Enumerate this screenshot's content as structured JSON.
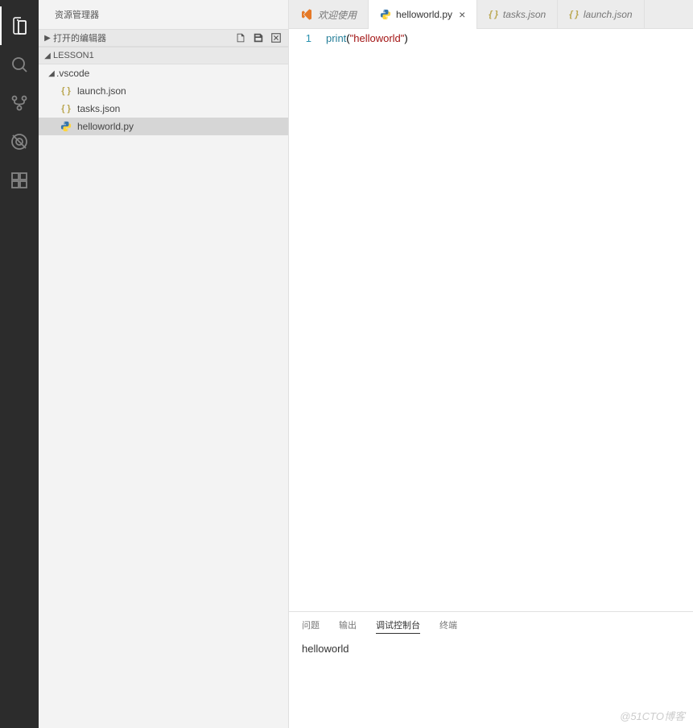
{
  "activity_bar": {
    "items": [
      "files",
      "search",
      "source-control",
      "debug",
      "extensions"
    ]
  },
  "sidebar": {
    "title": "资源管理器",
    "sections": {
      "open_editors": {
        "label": "打开的编辑器",
        "expanded": false
      },
      "folder": {
        "label": "LESSON1",
        "expanded": true,
        "tree": [
          {
            "type": "folder",
            "name": ".vscode",
            "expanded": true,
            "depth": 0
          },
          {
            "type": "file",
            "name": "launch.json",
            "icon": "json",
            "depth": 1
          },
          {
            "type": "file",
            "name": "tasks.json",
            "icon": "json",
            "depth": 1
          },
          {
            "type": "file",
            "name": "helloworld.py",
            "icon": "python",
            "depth": 0,
            "selected": true
          }
        ]
      }
    }
  },
  "tabs": [
    {
      "label": "欢迎使用",
      "icon": "vscode",
      "active": false
    },
    {
      "label": "helloworld.py",
      "icon": "python",
      "active": true,
      "close": "×"
    },
    {
      "label": "tasks.json",
      "icon": "json",
      "active": false
    },
    {
      "label": "launch.json",
      "icon": "json",
      "active": false
    }
  ],
  "editor": {
    "lines": [
      {
        "num": "1",
        "tokens": [
          {
            "cls": "fn",
            "t": "print"
          },
          {
            "cls": "",
            "t": "("
          },
          {
            "cls": "str",
            "t": "\"helloworld\""
          },
          {
            "cls": "",
            "t": ")"
          }
        ]
      }
    ]
  },
  "panel": {
    "tabs": [
      {
        "label": "问题",
        "active": false
      },
      {
        "label": "输出",
        "active": false
      },
      {
        "label": "调试控制台",
        "active": true
      },
      {
        "label": "终端",
        "active": false
      }
    ],
    "output": "helloworld"
  },
  "watermark": "@51CTO博客",
  "icons": {
    "json_glyph": "{ }"
  }
}
